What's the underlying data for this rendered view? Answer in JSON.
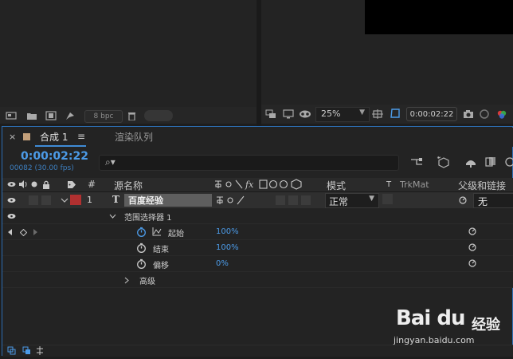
{
  "project_panel": {
    "bpc_label": "8 bpc"
  },
  "viewer_panel": {
    "zoom": "25%",
    "timecode": "0:00:02:22"
  },
  "timeline": {
    "tab_close": "×",
    "tab_title": "合成 1",
    "tab_menu": "≡",
    "tab_render_queue": "渲染队列",
    "current_time": "0:00:02:22",
    "frame_info": "00082 (30.00 fps)",
    "columns": {
      "hash": "#",
      "source_name": "源名称",
      "mode": "模式",
      "t": "T",
      "trkmat": "TrkMat",
      "parent": "父级和链接"
    },
    "layer": {
      "index": "1",
      "type_glyph": "T",
      "name": "百度经验",
      "mode": "正常",
      "parent": "无"
    },
    "selector": {
      "name": "范围选择器 1",
      "properties": [
        {
          "name": "起始",
          "value": "100%"
        },
        {
          "name": "结束",
          "value": "100%"
        },
        {
          "name": "偏移",
          "value": "0%"
        }
      ],
      "advanced": "高级"
    }
  },
  "watermark": {
    "logo": "Bai du",
    "brand_cn": "经验",
    "url": "jingyan.baidu.com"
  },
  "colors": {
    "accent_blue": "#4c9be8",
    "panel_border": "#2d6fb4",
    "layer_label_red": "#b13030",
    "comp_swatch": "#c4a07a"
  }
}
